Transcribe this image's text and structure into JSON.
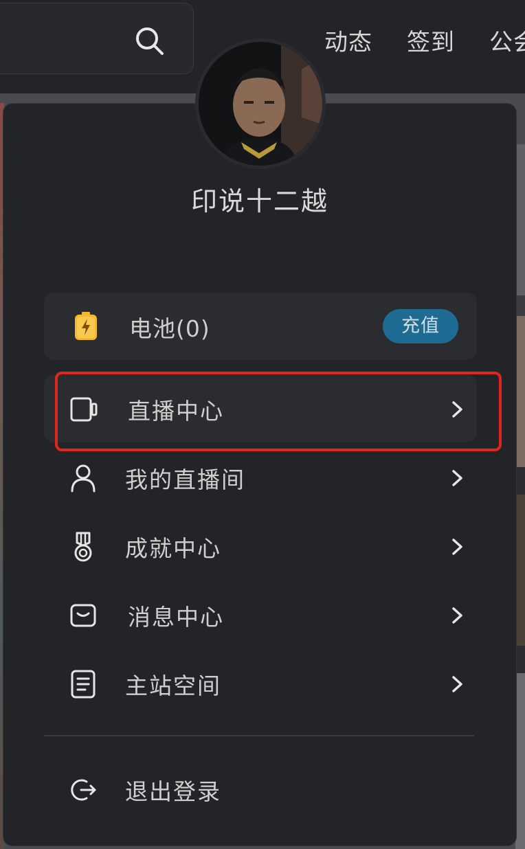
{
  "header": {
    "nav": [
      {
        "label": "动态"
      },
      {
        "label": "签到"
      },
      {
        "label": "公会"
      }
    ]
  },
  "profile": {
    "username": "印说十二越"
  },
  "battery": {
    "label": "电池(0)",
    "recharge_label": "充值",
    "icon": "battery-charging-icon"
  },
  "menu": [
    {
      "label": "直播中心",
      "icon": "live-center-icon",
      "active": true
    },
    {
      "label": "我的直播间",
      "icon": "user-icon",
      "active": false
    },
    {
      "label": "成就中心",
      "icon": "medal-icon",
      "active": false
    },
    {
      "label": "消息中心",
      "icon": "message-icon",
      "active": false
    },
    {
      "label": "主站空间",
      "icon": "document-icon",
      "active": false
    }
  ],
  "logout": {
    "label": "退出登录",
    "icon": "logout-icon"
  },
  "colors": {
    "accent": "#1e6b93",
    "highlight": "#e0261f",
    "battery": "#f7b731"
  }
}
